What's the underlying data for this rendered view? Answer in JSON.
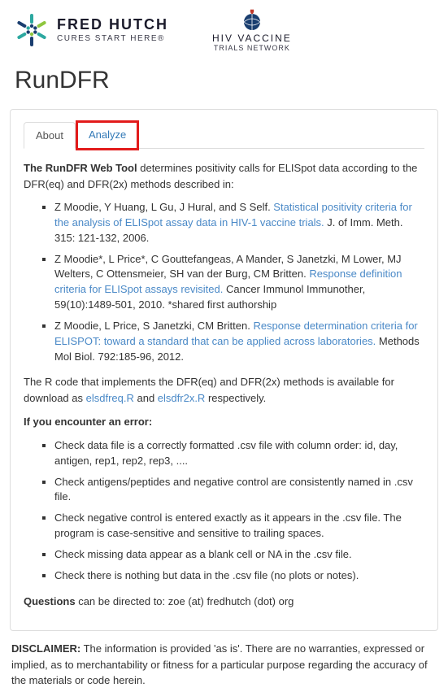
{
  "header": {
    "fredhutch_title": "FRED HUTCH",
    "fredhutch_sub": "CURES START HERE®",
    "hvtn_line1": "HIV VACCINE",
    "hvtn_line2": "TRIALS NETWORK"
  },
  "page_title": "RunDFR",
  "tabs": {
    "about": "About",
    "analyze": "Analyze"
  },
  "intro": {
    "strong": "The RunDFR Web Tool",
    "rest": " determines positivity calls for ELISpot data according to the DFR(eq) and DFR(2x) methods described in:"
  },
  "refs": [
    {
      "pre": "Z Moodie, Y Huang, L Gu, J Hural, and S Self. ",
      "link": "Statistical positivity criteria for the analysis of ELISpot assay data in HIV-1 vaccine trials.",
      "post": " J. of Imm. Meth. 315: 121-132, 2006."
    },
    {
      "pre": "Z Moodie*, L Price*, C Gouttefangeas, A Mander, S Janetzki, M Lower, MJ Welters, C Ottensmeier, SH van der Burg, CM Britten. ",
      "link": "Response definition criteria for ELISpot assays revisited.",
      "post": " Cancer Immunol Immunother, 59(10):1489-501, 2010. *shared first authorship"
    },
    {
      "pre": "Z Moodie, L Price, S Janetzki, CM Britten. ",
      "link": "Response determination criteria for ELISPOT: toward a standard that can be applied across laboratories.",
      "post": " Methods Mol Biol. 792:185-96, 2012."
    }
  ],
  "rcode": {
    "pre": "The R code that implements the DFR(eq) and DFR(2x) methods is available for download as ",
    "link1": "elsdfreq.R",
    "mid": " and ",
    "link2": "elsdfr2x.R",
    "post": " respectively."
  },
  "error_heading": "If you encounter an error:",
  "error_items": [
    "Check data file is a correctly formatted .csv file with column order: id, day, antigen, rep1, rep2, rep3, ....",
    "Check antigens/peptides and negative control are consistently named in .csv file.",
    "Check negative control is entered exactly as it appears in the .csv file. The program is case-sensitive and sensitive to trailing spaces.",
    "Check missing data appear as a blank cell or NA in the .csv file.",
    "Check there is nothing but data in the .csv file (no plots or notes)."
  ],
  "questions": {
    "strong": "Questions",
    "rest": " can be directed to: zoe (at) fredhutch (dot) org"
  },
  "disclaimer": {
    "strong": "DISCLAIMER:",
    "rest": " The information is provided 'as is'. There are no warranties, expressed or implied, as to merchantability or fitness for a particular purpose regarding the accuracy of the materials or code herein."
  }
}
